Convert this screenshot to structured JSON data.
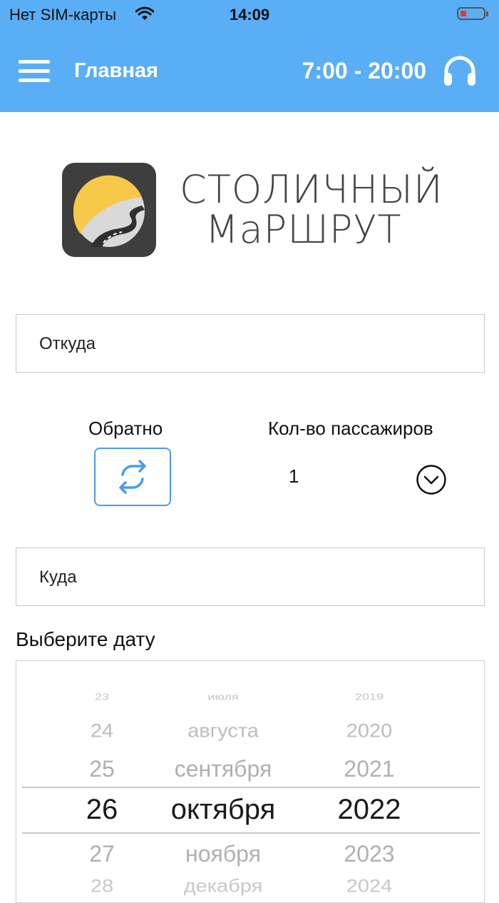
{
  "status_bar": {
    "carrier": "Нет SIM-карты",
    "time": "14:09"
  },
  "header": {
    "title": "Главная",
    "hours": "7:00 - 20:00",
    "background": "#5AAEF5"
  },
  "brand": {
    "line1": "СТОЛИЧНЫЙ",
    "line2": "МаРШРУТ"
  },
  "form": {
    "from_placeholder": "Откуда",
    "return_label": "Обратно",
    "passengers_label": "Кол-во пассажиров",
    "passengers_value": "1",
    "to_placeholder": "Куда",
    "date_label": "Выберите дату"
  },
  "date_picker": {
    "days": [
      "23",
      "24",
      "25",
      "26",
      "27",
      "28"
    ],
    "months": [
      "июля",
      "августа",
      "сентября",
      "октября",
      "ноября",
      "декабря"
    ],
    "years": [
      "2019",
      "2020",
      "2021",
      "2022",
      "2023",
      "2024"
    ],
    "selected": {
      "day": "26",
      "month": "октября",
      "year": "2022"
    }
  },
  "icons": {
    "menu": "hamburger-menu-icon",
    "support": "headset-icon",
    "swap": "swap-arrows-icon",
    "dropdown": "chevron-down-circle-icon",
    "wifi": "wifi-icon",
    "battery": "battery-low-icon"
  },
  "colors": {
    "accent": "#4C9BE8",
    "logo_yellow": "#F7C948",
    "logo_dark": "#3E3E3E"
  }
}
